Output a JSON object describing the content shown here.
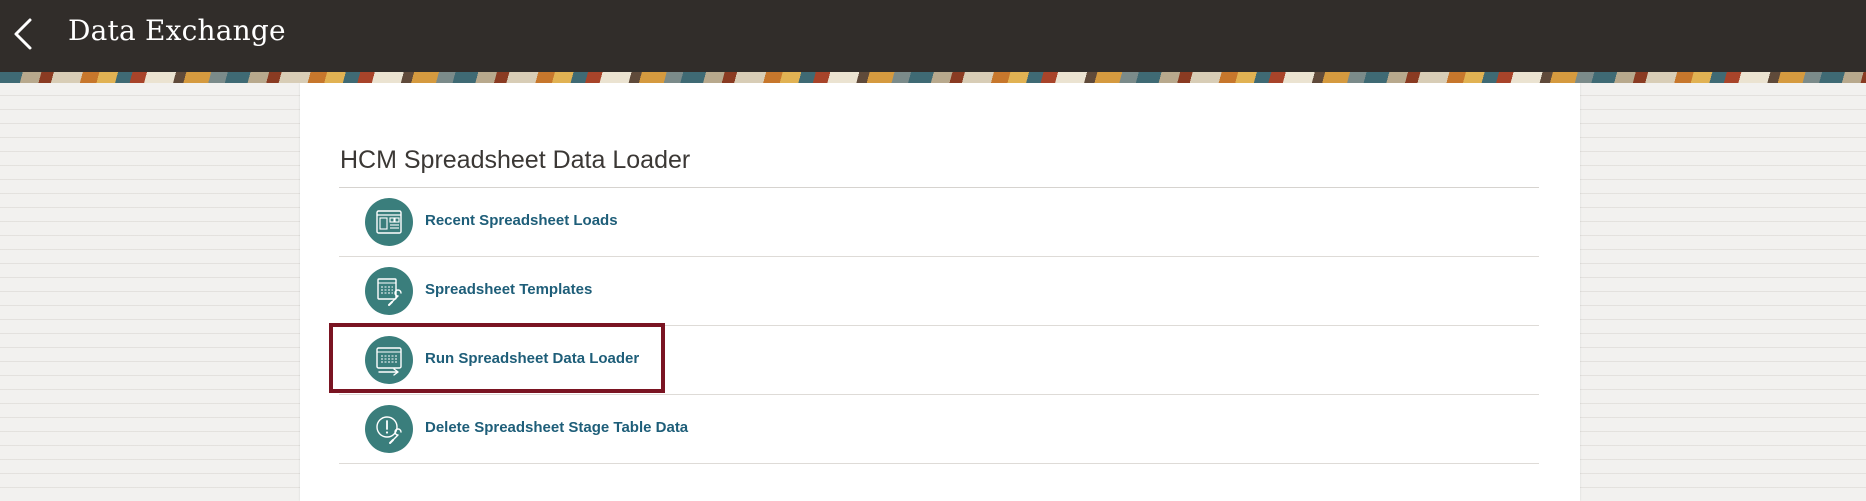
{
  "header": {
    "title": "Data Exchange",
    "back_icon": "chevron-left-icon"
  },
  "section": {
    "title": "HCM Spreadsheet Data Loader"
  },
  "tasks": [
    {
      "label": "Recent Spreadsheet Loads",
      "icon": "recent-loads-icon"
    },
    {
      "label": "Spreadsheet Templates",
      "icon": "templates-icon"
    },
    {
      "label": "Run Spreadsheet Data Loader",
      "icon": "run-loader-icon",
      "highlighted": true
    },
    {
      "label": "Delete Spreadsheet Stage Table Data",
      "icon": "delete-stage-data-icon"
    }
  ],
  "colors": {
    "header_bg": "#312d2a",
    "icon_bg": "#3a7e7c",
    "link": "#1e5e79",
    "highlight": "#7a1422"
  }
}
